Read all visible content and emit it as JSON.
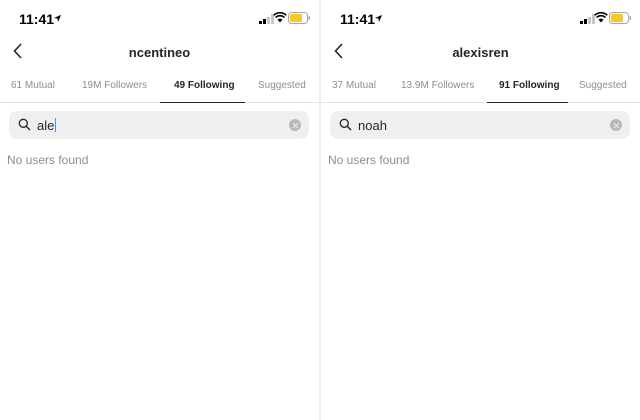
{
  "status_bar": {
    "time": "11:41"
  },
  "panels": [
    {
      "username": "ncentineo",
      "tabs": [
        "61 Mutual",
        "19M Followers",
        "49 Following",
        "Suggested"
      ],
      "active_tab": "49 Following",
      "search_value": "ale",
      "empty_message": "No users found"
    },
    {
      "username": "alexisren",
      "tabs": [
        "37 Mutual",
        "13.9M Followers",
        "91 Following",
        "Suggested"
      ],
      "active_tab": "91 Following",
      "search_value": "noah",
      "empty_message": "No users found"
    }
  ],
  "colors": {
    "battery": "#f7c82b",
    "active_underline": "#262626",
    "caret": "#3897f0"
  },
  "icons": [
    "location-arrow-icon",
    "signal-icon",
    "wifi-icon",
    "battery-icon",
    "back-chevron-icon",
    "search-icon",
    "clear-icon"
  ]
}
